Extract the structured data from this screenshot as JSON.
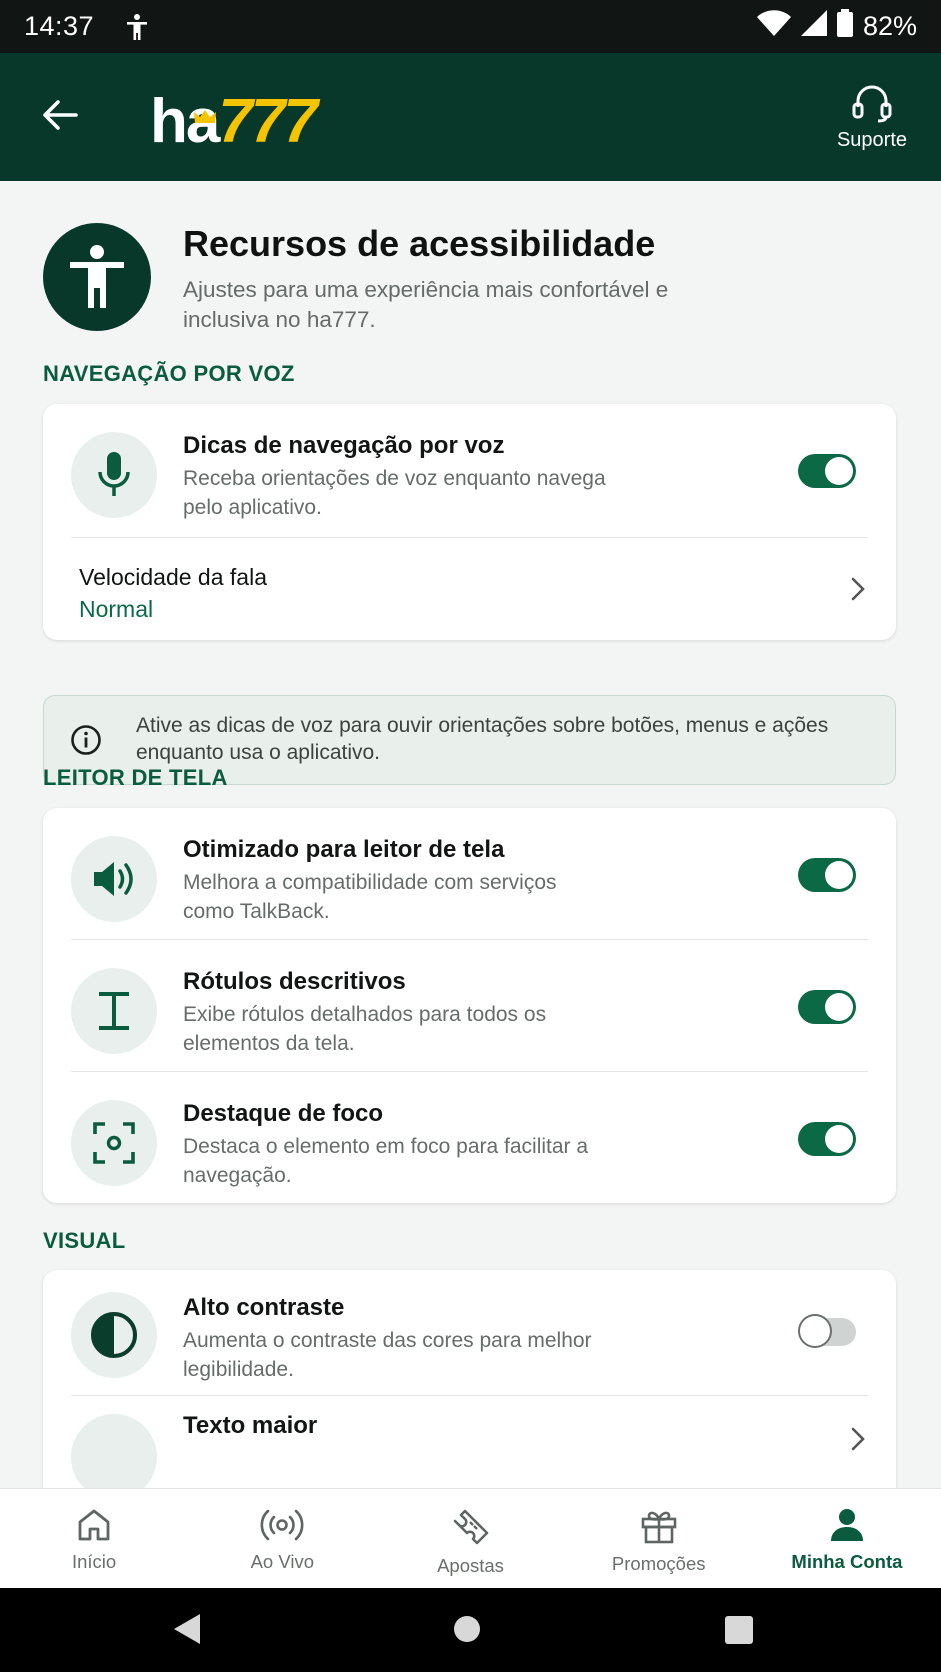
{
  "status_bar": {
    "time": "14:37",
    "battery": "82%"
  },
  "header": {
    "logo_white": "ha",
    "logo_yellow": "777",
    "support_label": "Suporte"
  },
  "hero": {
    "title": "Recursos de acessibilidade",
    "subtitle": "Ajustes para uma experiência mais confortável e inclusiva no ha777."
  },
  "sections": {
    "voice": {
      "title": "NAVEGAÇÃO POR VOZ",
      "items": [
        {
          "title": "Dicas de navegação por voz",
          "desc": "Receba orientações de voz enquanto navega pelo aplicativo.",
          "enabled": true,
          "icon": "microphone-icon"
        }
      ],
      "speed": {
        "label": "Velocidade da fala",
        "value": "Normal"
      },
      "info": "Ative as dicas de voz para ouvir orientações sobre botões, menus e ações enquanto usa o aplicativo."
    },
    "screen_reader": {
      "title": "LEITOR DE TELA",
      "items": [
        {
          "title": "Otimizado para leitor de tela",
          "desc": "Melhora a compatibilidade com serviços como TalkBack.",
          "enabled": true,
          "icon": "speaker-icon"
        },
        {
          "title": "Rótulos descritivos",
          "desc": "Exibe rótulos detalhados para todos os elementos da tela.",
          "enabled": true,
          "icon": "text-cursor-icon"
        },
        {
          "title": "Destaque de foco",
          "desc": "Destaca o elemento em foco para facilitar a navegação.",
          "enabled": true,
          "icon": "focus-frame-icon"
        }
      ]
    },
    "visual": {
      "title": "VISUAL",
      "items": [
        {
          "title": "Alto contraste",
          "desc": "Aumenta o contraste das cores para melhor legibilidade.",
          "enabled": false,
          "icon": "contrast-icon"
        },
        {
          "title": "Texto maior",
          "icon": "text-size-icon"
        }
      ]
    }
  },
  "bottom_nav": [
    {
      "label": "Início",
      "icon": "home-icon",
      "active": false
    },
    {
      "label": "Ao Vivo",
      "icon": "live-broadcast-icon",
      "active": false
    },
    {
      "label": "Apostas",
      "icon": "ticket-icon",
      "active": false
    },
    {
      "label": "Promoções",
      "icon": "gift-icon",
      "active": false
    },
    {
      "label": "Minha Conta",
      "icon": "user-icon",
      "active": true
    }
  ],
  "colors": {
    "primary": "#07382a",
    "accent": "#0b6a45",
    "logo_yellow": "#f5c400"
  }
}
